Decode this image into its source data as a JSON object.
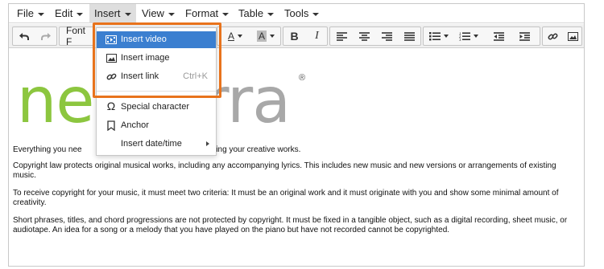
{
  "menubar": {
    "items": [
      {
        "label": "File"
      },
      {
        "label": "Edit"
      },
      {
        "label": "Insert"
      },
      {
        "label": "View"
      },
      {
        "label": "Format"
      },
      {
        "label": "Table"
      },
      {
        "label": "Tools"
      }
    ],
    "active": "Insert"
  },
  "toolbar": {
    "font_label": "Font F",
    "icons": [
      "undo-icon",
      "redo-icon",
      "font-family-select",
      "text-color-icon",
      "background-color-icon",
      "bold-icon",
      "italic-icon",
      "align-left-icon",
      "align-center-icon",
      "align-right-icon",
      "justify-icon",
      "bullet-list-icon",
      "numbered-list-icon",
      "outdent-icon",
      "indent-icon",
      "link-icon",
      "image-icon"
    ],
    "bold": "B",
    "italic": "I",
    "text_color_glyph": "A",
    "bg_color_glyph": "A"
  },
  "insert_menu": {
    "items": [
      {
        "label": "Insert video",
        "icon": "video-icon",
        "selected": true
      },
      {
        "label": "Insert image",
        "icon": "image-icon"
      },
      {
        "label": "Insert link",
        "icon": "link-icon",
        "shortcut": "Ctrl+K"
      },
      {
        "label": "Special character",
        "icon": "omega-icon"
      },
      {
        "label": "Anchor",
        "icon": "bookmark-icon"
      },
      {
        "label": "Insert date/time",
        "submenu": true
      }
    ]
  },
  "content": {
    "logo_green": "ne",
    "logo_grey": "rra",
    "registered": "®",
    "paragraphs": [
      "Everything you nee                                              d protecting your creative works.",
      "Copyright law protects original musical works, including any accompanying lyrics. This includes new music and new versions or arrangements of existing music.",
      "To receive copyright for your music, it must meet two criteria: It must be an original work and it must originate with you and show some minimal amount of creativity.",
      "Short phrases, titles, and chord progressions are not protected by copyright. It must be fixed in a tangible object, such as a digital recording, sheet music, or audiotape. An idea for a song or a melody that you have played on the piano but have not recorded cannot be copyrighted."
    ]
  },
  "colors": {
    "accent_highlight": "#e8731c",
    "selected_bg": "#3b7fd0",
    "logo_green": "#8cc63f",
    "logo_grey": "#a8a8a8"
  }
}
